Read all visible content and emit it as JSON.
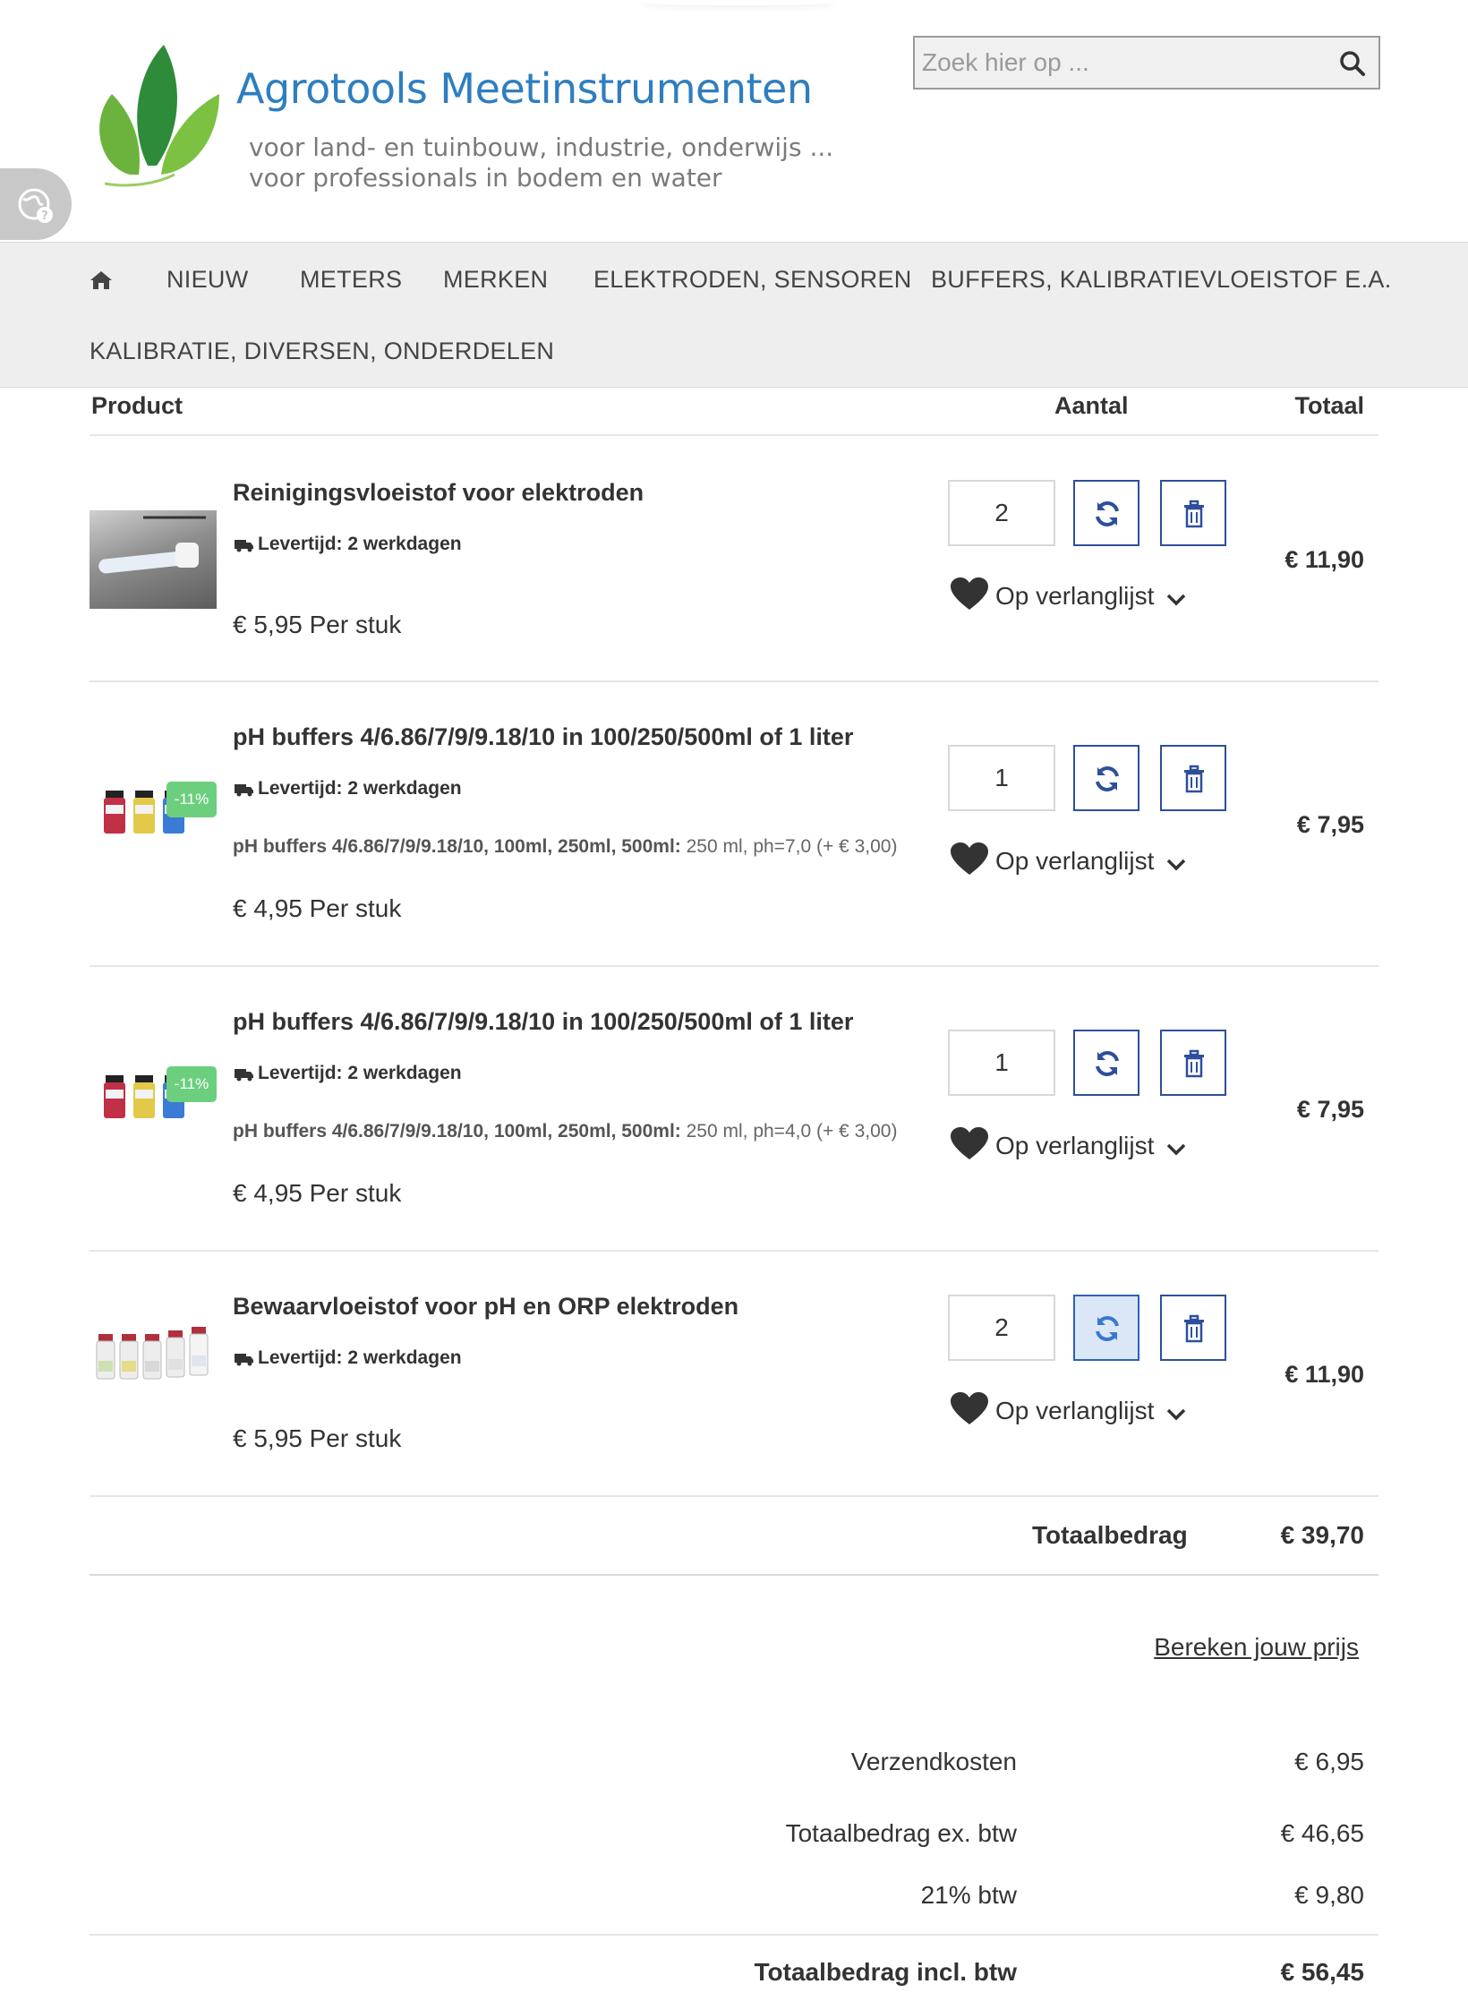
{
  "header": {
    "logo_title": "Agrotools Meetinstrumenten",
    "logo_sub_1": "voor land- en tuinbouw, industrie, onderwijs ...",
    "logo_sub_2": "voor professionals in bodem en water",
    "search_placeholder": "Zoek hier op ..."
  },
  "nav": {
    "items": [
      "NIEUW",
      "METERS",
      "MERKEN",
      "ELEKTRODEN, SENSOREN",
      "BUFFERS, KALIBRATIEVLOEISTOF E.A.",
      "KALIBRATIE, DIVERSEN, ONDERDELEN"
    ]
  },
  "table": {
    "col_product": "Product",
    "col_qty": "Aantal",
    "col_total": "Totaal"
  },
  "rows": [
    {
      "title": "Reinigingsvloeistof voor elektroden",
      "delivery": "Levertijd: 2 werkdagen",
      "unit_price": "€ 5,95 Per stuk",
      "qty": "2",
      "wish": "Op verlanglijst",
      "total": "€ 11,90"
    },
    {
      "title": "pH buffers 4/6.86/7/9/9.18/10 in 100/250/500ml of 1 liter",
      "delivery": "Levertijd: 2 werkdagen",
      "badge": "-11%",
      "option_label": "pH buffers 4/6.86/7/9/9.18/10, 100ml, 250ml, 500ml:",
      "option_value": " 250 ml, ph=7,0 (+ € 3,00)",
      "unit_price": "€ 4,95 Per stuk",
      "qty": "1",
      "wish": "Op verlanglijst",
      "total": "€ 7,95"
    },
    {
      "title": "pH buffers 4/6.86/7/9/9.18/10 in 100/250/500ml of 1 liter",
      "delivery": "Levertijd: 2 werkdagen",
      "badge": "-11%",
      "option_label": "pH buffers 4/6.86/7/9/9.18/10, 100ml, 250ml, 500ml:",
      "option_value": " 250 ml, ph=4,0 (+ € 3,00)",
      "unit_price": "€ 4,95 Per stuk",
      "qty": "1",
      "wish": "Op verlanglijst",
      "total": "€ 7,95"
    },
    {
      "title": "Bewaarvloeistof voor pH en ORP elektroden",
      "delivery": "Levertijd: 2 werkdagen",
      "unit_price": "€ 5,95 Per stuk",
      "qty": "2",
      "wish": "Op verlanglijst",
      "total": "€ 11,90"
    }
  ],
  "subtotal": {
    "label": "Totaalbedrag",
    "value": "€ 39,70"
  },
  "calc_link": "Bereken jouw prijs",
  "summary": {
    "shipping_label": "Verzendkosten",
    "shipping_value": "€ 6,95",
    "ex_label": "Totaalbedrag ex. btw",
    "ex_value": "€ 46,65",
    "vat_label": "21% btw",
    "vat_value": "€ 9,80",
    "incl_label": "Totaalbedrag incl. btw",
    "incl_value": "€ 56,45"
  },
  "colors": {
    "accent": "#2e4f9b",
    "logo_blue": "#2e7ec0",
    "badge_green": "#6ccf7d",
    "nav_bg": "#eeeeee"
  }
}
